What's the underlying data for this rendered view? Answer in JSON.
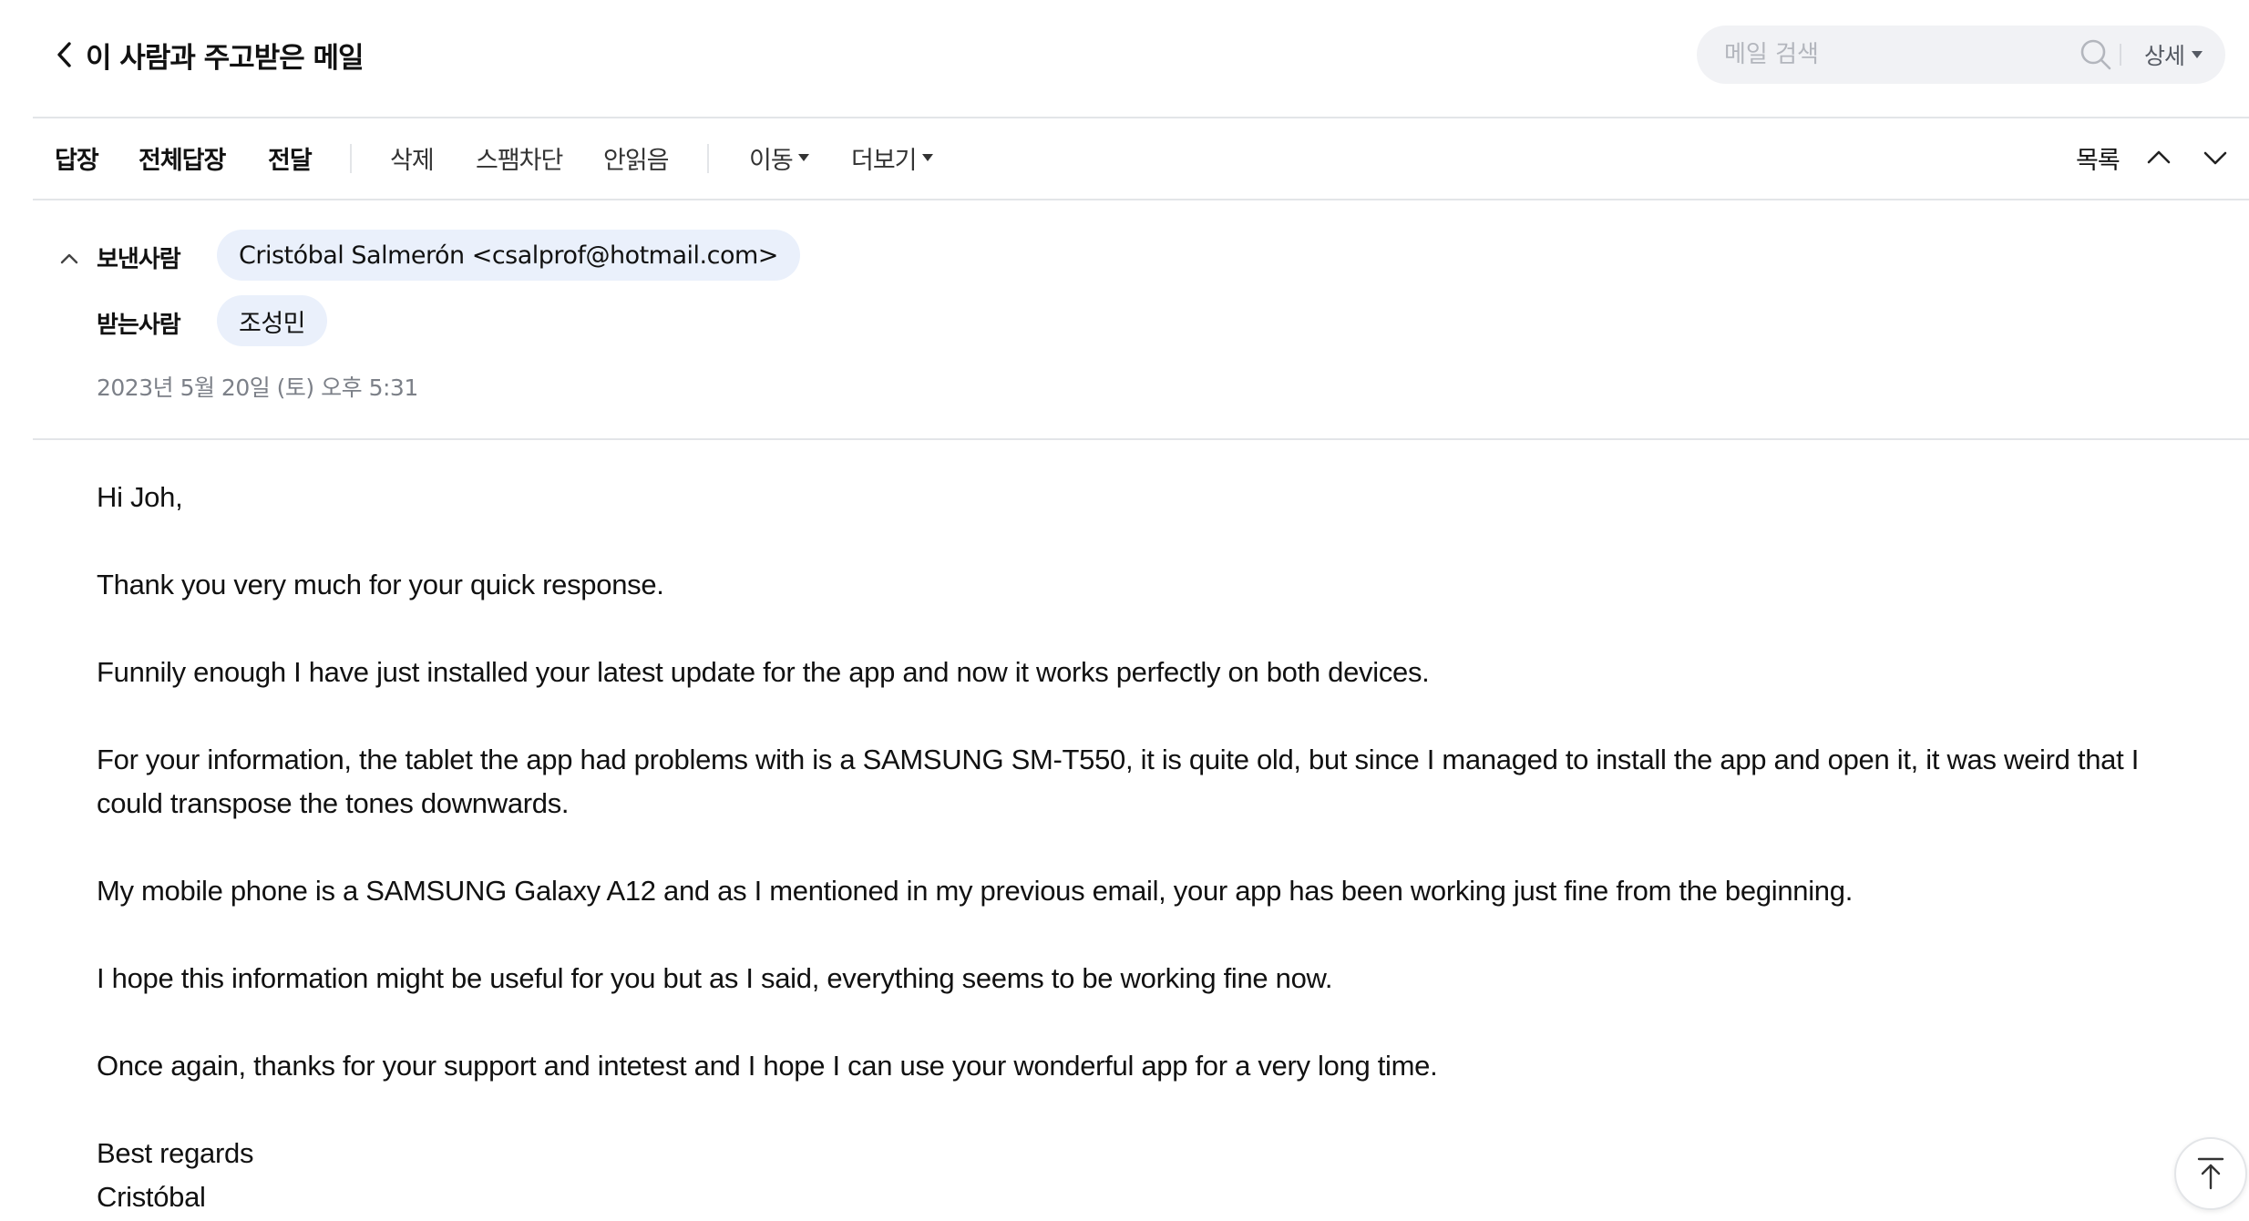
{
  "header": {
    "title": "이 사람과 주고받은 메일",
    "search_placeholder": "메일 검색",
    "detail_label": "상세"
  },
  "toolbar": {
    "reply": "답장",
    "reply_all": "전체답장",
    "forward": "전달",
    "delete": "삭제",
    "block_spam": "스팸차단",
    "mark_unread": "안읽음",
    "move": "이동",
    "more": "더보기",
    "list": "목록"
  },
  "meta": {
    "from_label": "보낸사람",
    "from_value": "Cristóbal Salmerón <csalprof@hotmail.com>",
    "to_label": "받는사람",
    "to_value": "조성민",
    "date": "2023년 5월 20일 (토) 오후 5:31"
  },
  "body": {
    "greeting": "Hi Joh,",
    "p1": "Thank you very much for your quick response.",
    "p2": "Funnily enough I have just installed your latest update for the app and now it works perfectly on both devices.",
    "p3": "For your information, the tablet the app had problems with is a SAMSUNG SM-T550, it is quite old, but since I managed to install the app and open it, it was weird that I could transpose the tones downwards.",
    "p4": "My mobile phone is a SAMSUNG Galaxy A12 and as I mentioned in my previous email, your app has been working just fine from the beginning.",
    "p5": "I hope this information might be useful for you but as I said, everything seems to be working fine now.",
    "p6": "Once again, thanks for your support and intetest and I hope I can use your wonderful app for a very long time.",
    "closing": "Best regards",
    "signature": "Cristóbal"
  }
}
